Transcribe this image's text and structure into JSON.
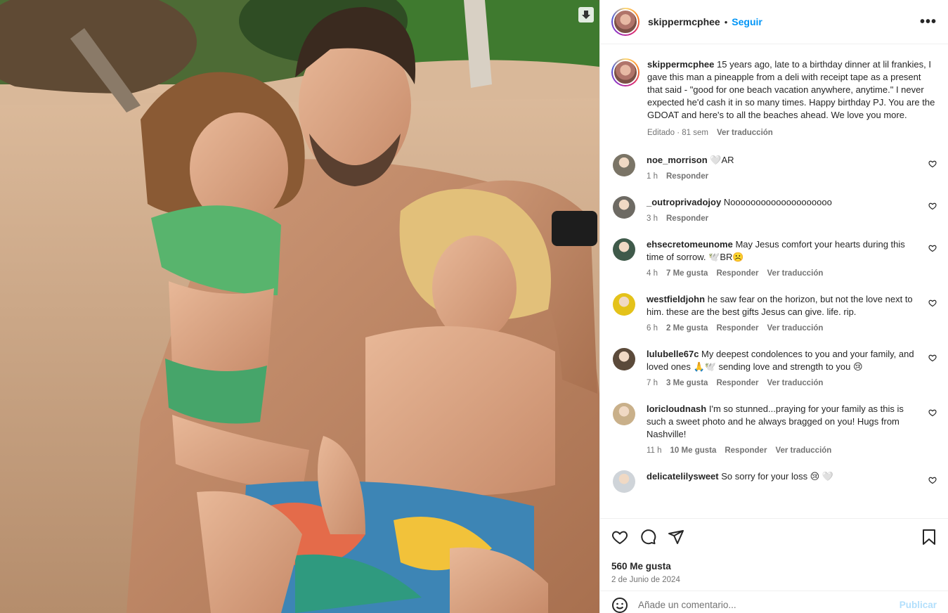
{
  "post": {
    "username": "skippermcphee",
    "follow_label": "Seguir",
    "separator": "•",
    "more_icon": "•••"
  },
  "caption": {
    "username": "skippermcphee",
    "text": "15 years ago, late to a birthday dinner at lil frankies, I gave this man a pineapple from a deli with receipt tape as a present that said - \"good for one beach vacation anywhere, anytime.\" I never expected he'd cash it in so many times. Happy birthday PJ. You are the GDOAT and here's to all the beaches ahead. We love you more.",
    "edited": "Editado · 81 sem",
    "translate": "Ver traducción"
  },
  "comments": [
    {
      "username": "noe_morrison",
      "text": "🤍AR",
      "time": "1 h",
      "likes": "",
      "reply": "Responder",
      "translate": "",
      "avatar_color": "#7a7466"
    },
    {
      "username": "_outroprivadojoy",
      "text": "Noooooooooooooooooooo",
      "time": "3 h",
      "likes": "",
      "reply": "Responder",
      "translate": "",
      "avatar_color": "#6d6a63"
    },
    {
      "username": "ehsecretomeunome",
      "text": "May Jesus comfort your hearts during this time of sorrow. 🕊️BR☹️",
      "time": "4 h",
      "likes": "7 Me gusta",
      "reply": "Responder",
      "translate": "Ver traducción",
      "avatar_color": "#3f5a4a"
    },
    {
      "username": "westfieldjohn",
      "text": "he saw fear on the horizon, but not the love next to him. these are the best gifts Jesus can give. life. rip.",
      "time": "6 h",
      "likes": "2 Me gusta",
      "reply": "Responder",
      "translate": "Ver traducción",
      "avatar_color": "#e4c21a"
    },
    {
      "username": "lulubelle67c",
      "text": "My deepest condolences to you and your family, and loved ones 🙏🕊️ sending love and strength to you 😢",
      "time": "7 h",
      "likes": "3 Me gusta",
      "reply": "Responder",
      "translate": "Ver traducción",
      "avatar_color": "#5b4a3a"
    },
    {
      "username": "loricloudnash",
      "text": "I'm so stunned...praying for your family as this is such a sweet photo and he always bragged on you! Hugs from Nashville!",
      "time": "11 h",
      "likes": "10 Me gusta",
      "reply": "Responder",
      "translate": "Ver traducción",
      "avatar_color": "#c9b08a"
    },
    {
      "username": "delicatelilysweet",
      "text": "So sorry for your loss 😢 🤍",
      "time": "",
      "likes": "",
      "reply": "",
      "translate": "",
      "avatar_color": "#cfd4d9"
    }
  ],
  "footer": {
    "likes": "560 Me gusta",
    "date": "2 de Junio de 2024",
    "comment_placeholder": "Añade un comentario...",
    "post_label": "Publicar"
  },
  "colors": {
    "accent": "#0095f6",
    "post_disabled": "#b2dffc",
    "secondary_text": "#737373"
  }
}
